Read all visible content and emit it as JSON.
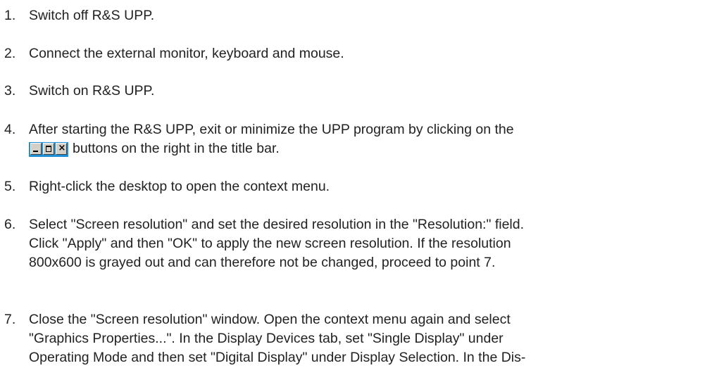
{
  "steps": [
    {
      "number": "1.",
      "lines": [
        "Switch off R&S UPP."
      ]
    },
    {
      "number": "2.",
      "lines": [
        "Connect the external monitor, keyboard and mouse."
      ]
    },
    {
      "number": "3.",
      "lines": [
        "Switch on R&S UPP."
      ]
    },
    {
      "number": "4.",
      "lines": [
        "After starting the R&S UPP, exit or minimize the UPP program by clicking on the",
        "buttons on the right in the title bar."
      ],
      "inline_icon": {
        "name": "title-bar-buttons-icon",
        "glyphs": [
          "minimize",
          "maximize",
          "close"
        ],
        "close_glyph": "×",
        "colors": {
          "frame": "#1e90d8",
          "button": "#d4d0c8"
        }
      }
    },
    {
      "number": "5.",
      "lines": [
        "Right-click the desktop to open the context menu."
      ]
    },
    {
      "number": "6.",
      "lines": [
        "Select \"Screen resolution\" and set the desired resolution in the \"Resolution:\" field.",
        "Click \"Apply\" and then \"OK\" to apply the new screen resolution. If the resolution",
        "800x600 is grayed out and can therefore not be changed, proceed to point 7."
      ]
    },
    {
      "number": "7.",
      "lines": [
        "Close the \"Screen resolution\" window. Open the context menu again and select",
        "\"Graphics Properties...\". In the Display Devices tab, set \"Single Display\" under",
        "Operating Mode and then set \"Digital Display\" under Display Selection. In the Dis-"
      ]
    }
  ]
}
